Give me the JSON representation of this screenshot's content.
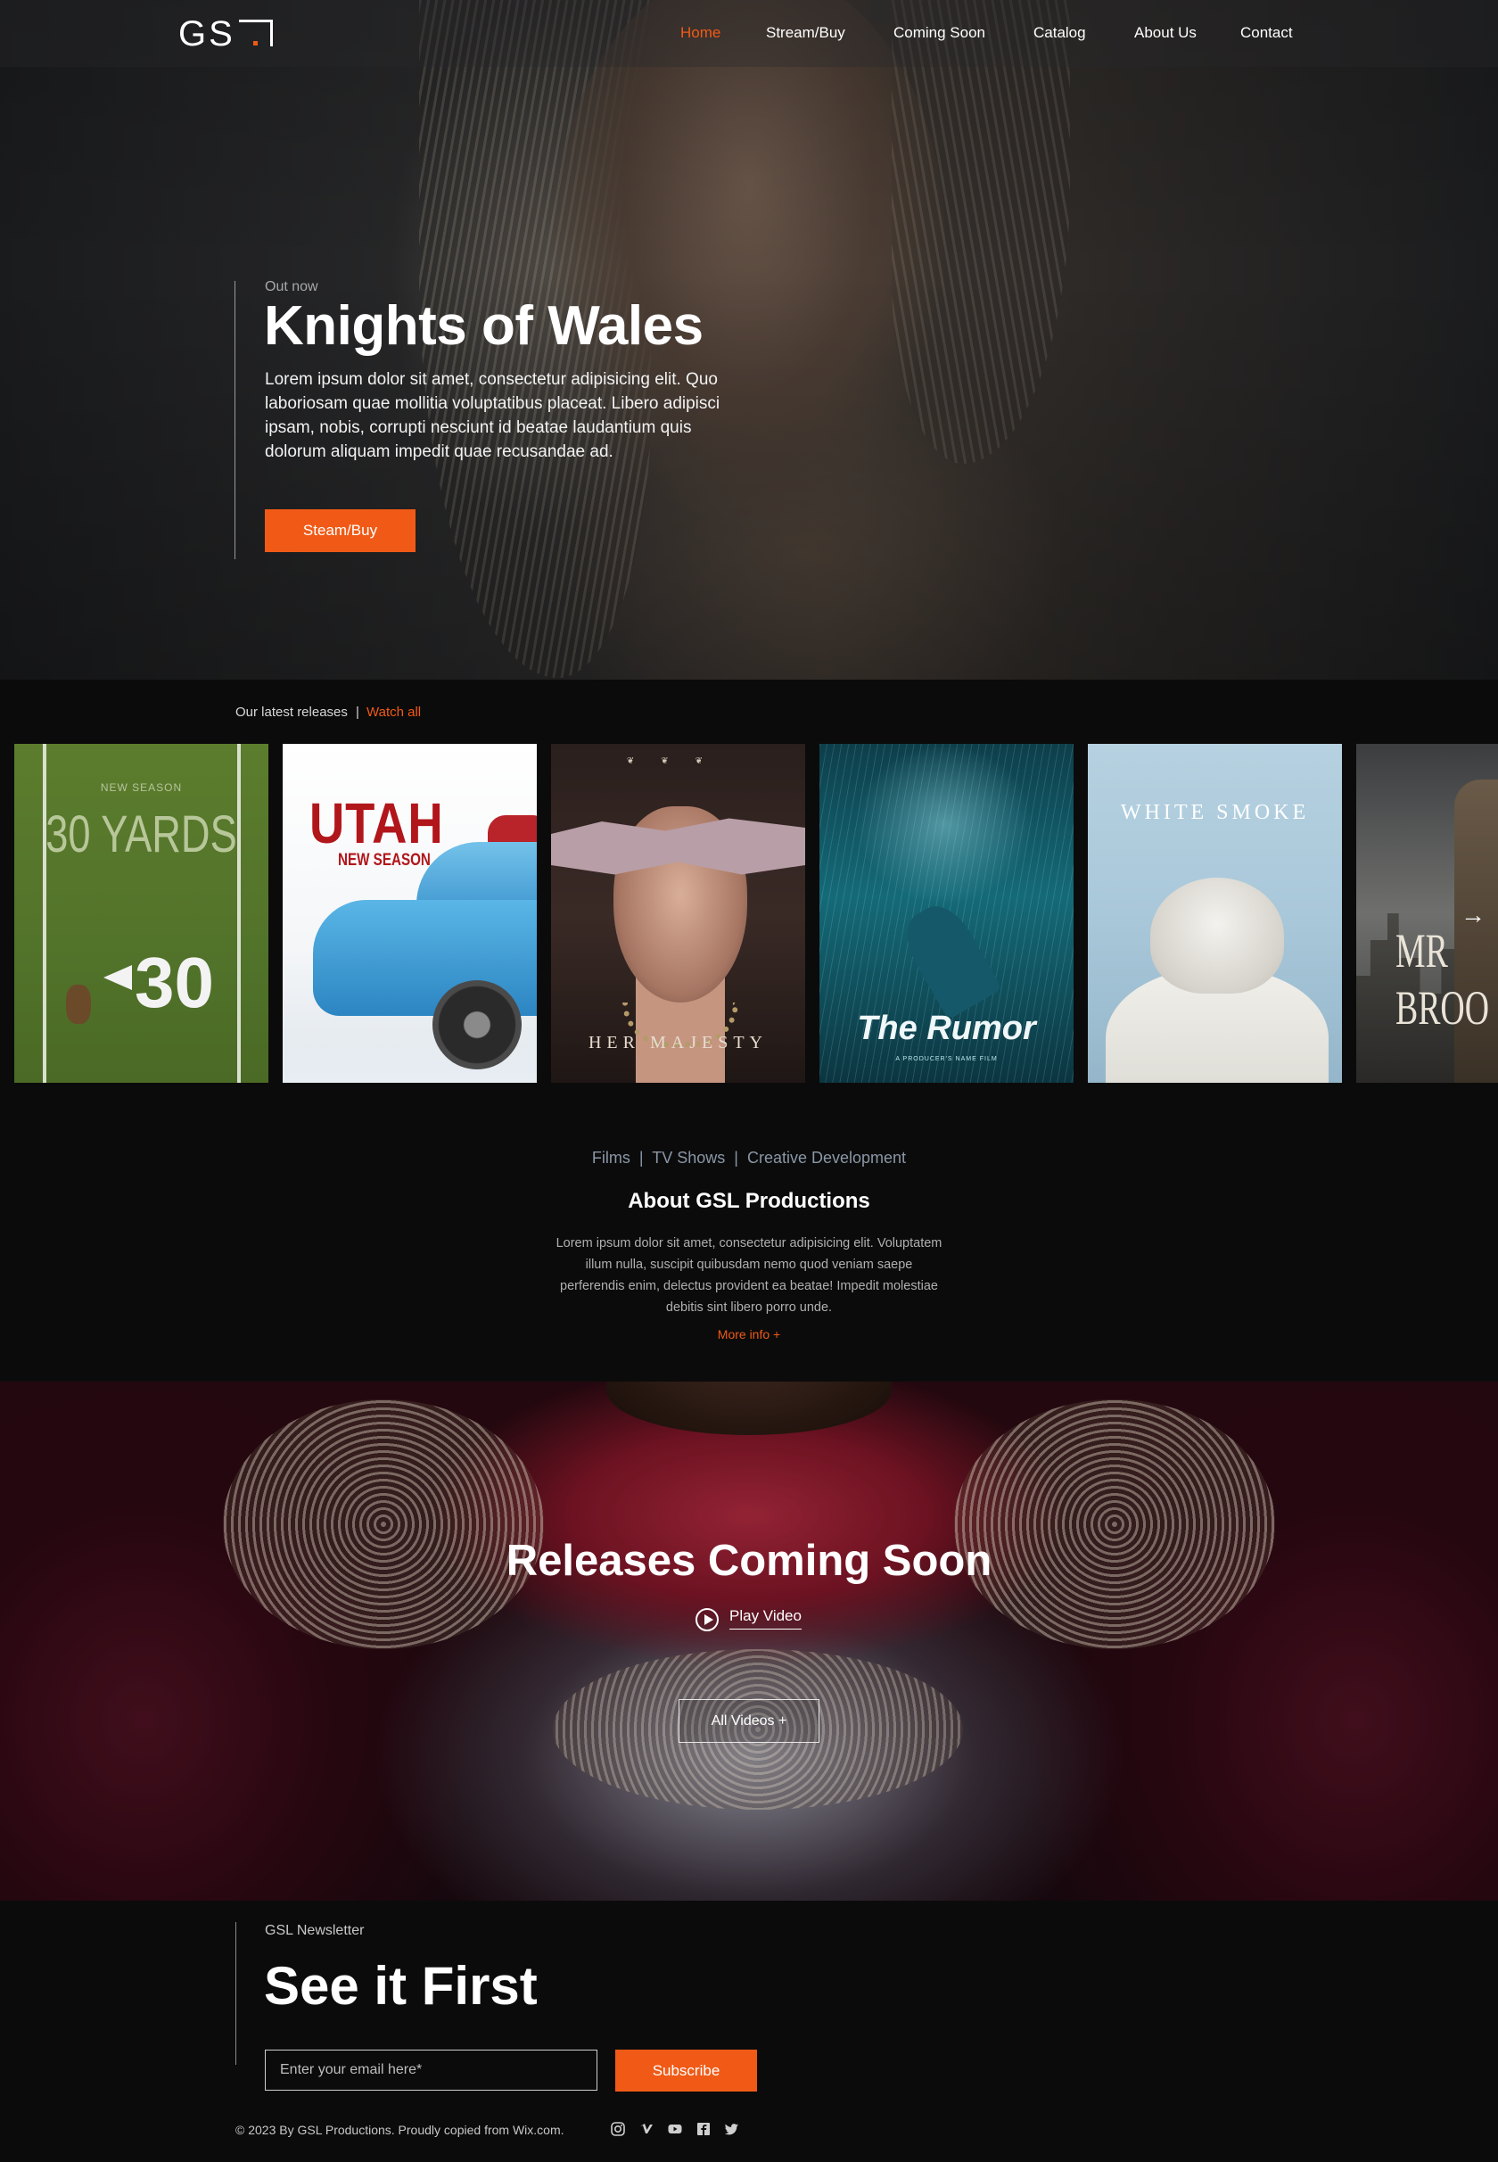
{
  "nav": {
    "logo": "GS",
    "items": [
      {
        "label": "Home",
        "active": true
      },
      {
        "label": "Stream/Buy",
        "active": false
      },
      {
        "label": "Coming Soon",
        "active": false
      },
      {
        "label": "Catalog",
        "active": false
      },
      {
        "label": "About Us",
        "active": false
      },
      {
        "label": "Contact",
        "active": false
      }
    ]
  },
  "hero": {
    "kicker": "Out now",
    "title": "Knights of Wales",
    "description": "Lorem ipsum dolor sit amet, consectetur adipisicing elit. Quo laboriosam quae mollitia voluptatibus placeat. Libero adipisci ipsam, nobis, corrupti nesciunt id beatae laudantium quis dolorum aliquam impedit quae recusandae ad.",
    "button": "Steam/Buy"
  },
  "releases": {
    "heading": "Our latest releases",
    "separator": "|",
    "link": "Watch all",
    "posters": [
      {
        "sup": "NEW SEASON",
        "title": "30 YARDS",
        "number": "30"
      },
      {
        "title": "UTAH",
        "subtitle": "NEW SEASON"
      },
      {
        "title": "HER MAJESTY"
      },
      {
        "title": "The Rumor",
        "tagline": "A PRODUCER'S NAME FILM"
      },
      {
        "title": "WHITE SMOKE"
      },
      {
        "title": "MR BROO"
      }
    ],
    "next_icon": "chevron-right-icon"
  },
  "about": {
    "categories": "Films  |  TV Shows  |  Creative Development",
    "title": "About GSL Productions",
    "text": "Lorem ipsum dolor sit amet, consectetur adipisicing elit. Voluptatem illum nulla, suscipit quibusdam nemo quod veniam saepe perferendis enim, delectus provident ea beatae! Impedit molestiae debitis sint libero porro unde.",
    "more": "More info +"
  },
  "coming_soon": {
    "title": "Releases Coming Soon",
    "play_label": "Play Video",
    "all_videos": "All Videos +"
  },
  "newsletter": {
    "kicker": "GSL Newsletter",
    "title": "See it First",
    "email_placeholder": "Enter your email here*",
    "subscribe": "Subscribe"
  },
  "footer": {
    "copyright": "© 2023 By GSL Productions. Proudly copied from Wix.com.",
    "social": [
      "instagram-icon",
      "vimeo-icon",
      "youtube-icon",
      "facebook-icon",
      "twitter-icon"
    ]
  },
  "colors": {
    "accent": "#f05a16",
    "background": "#0b0b0b"
  }
}
